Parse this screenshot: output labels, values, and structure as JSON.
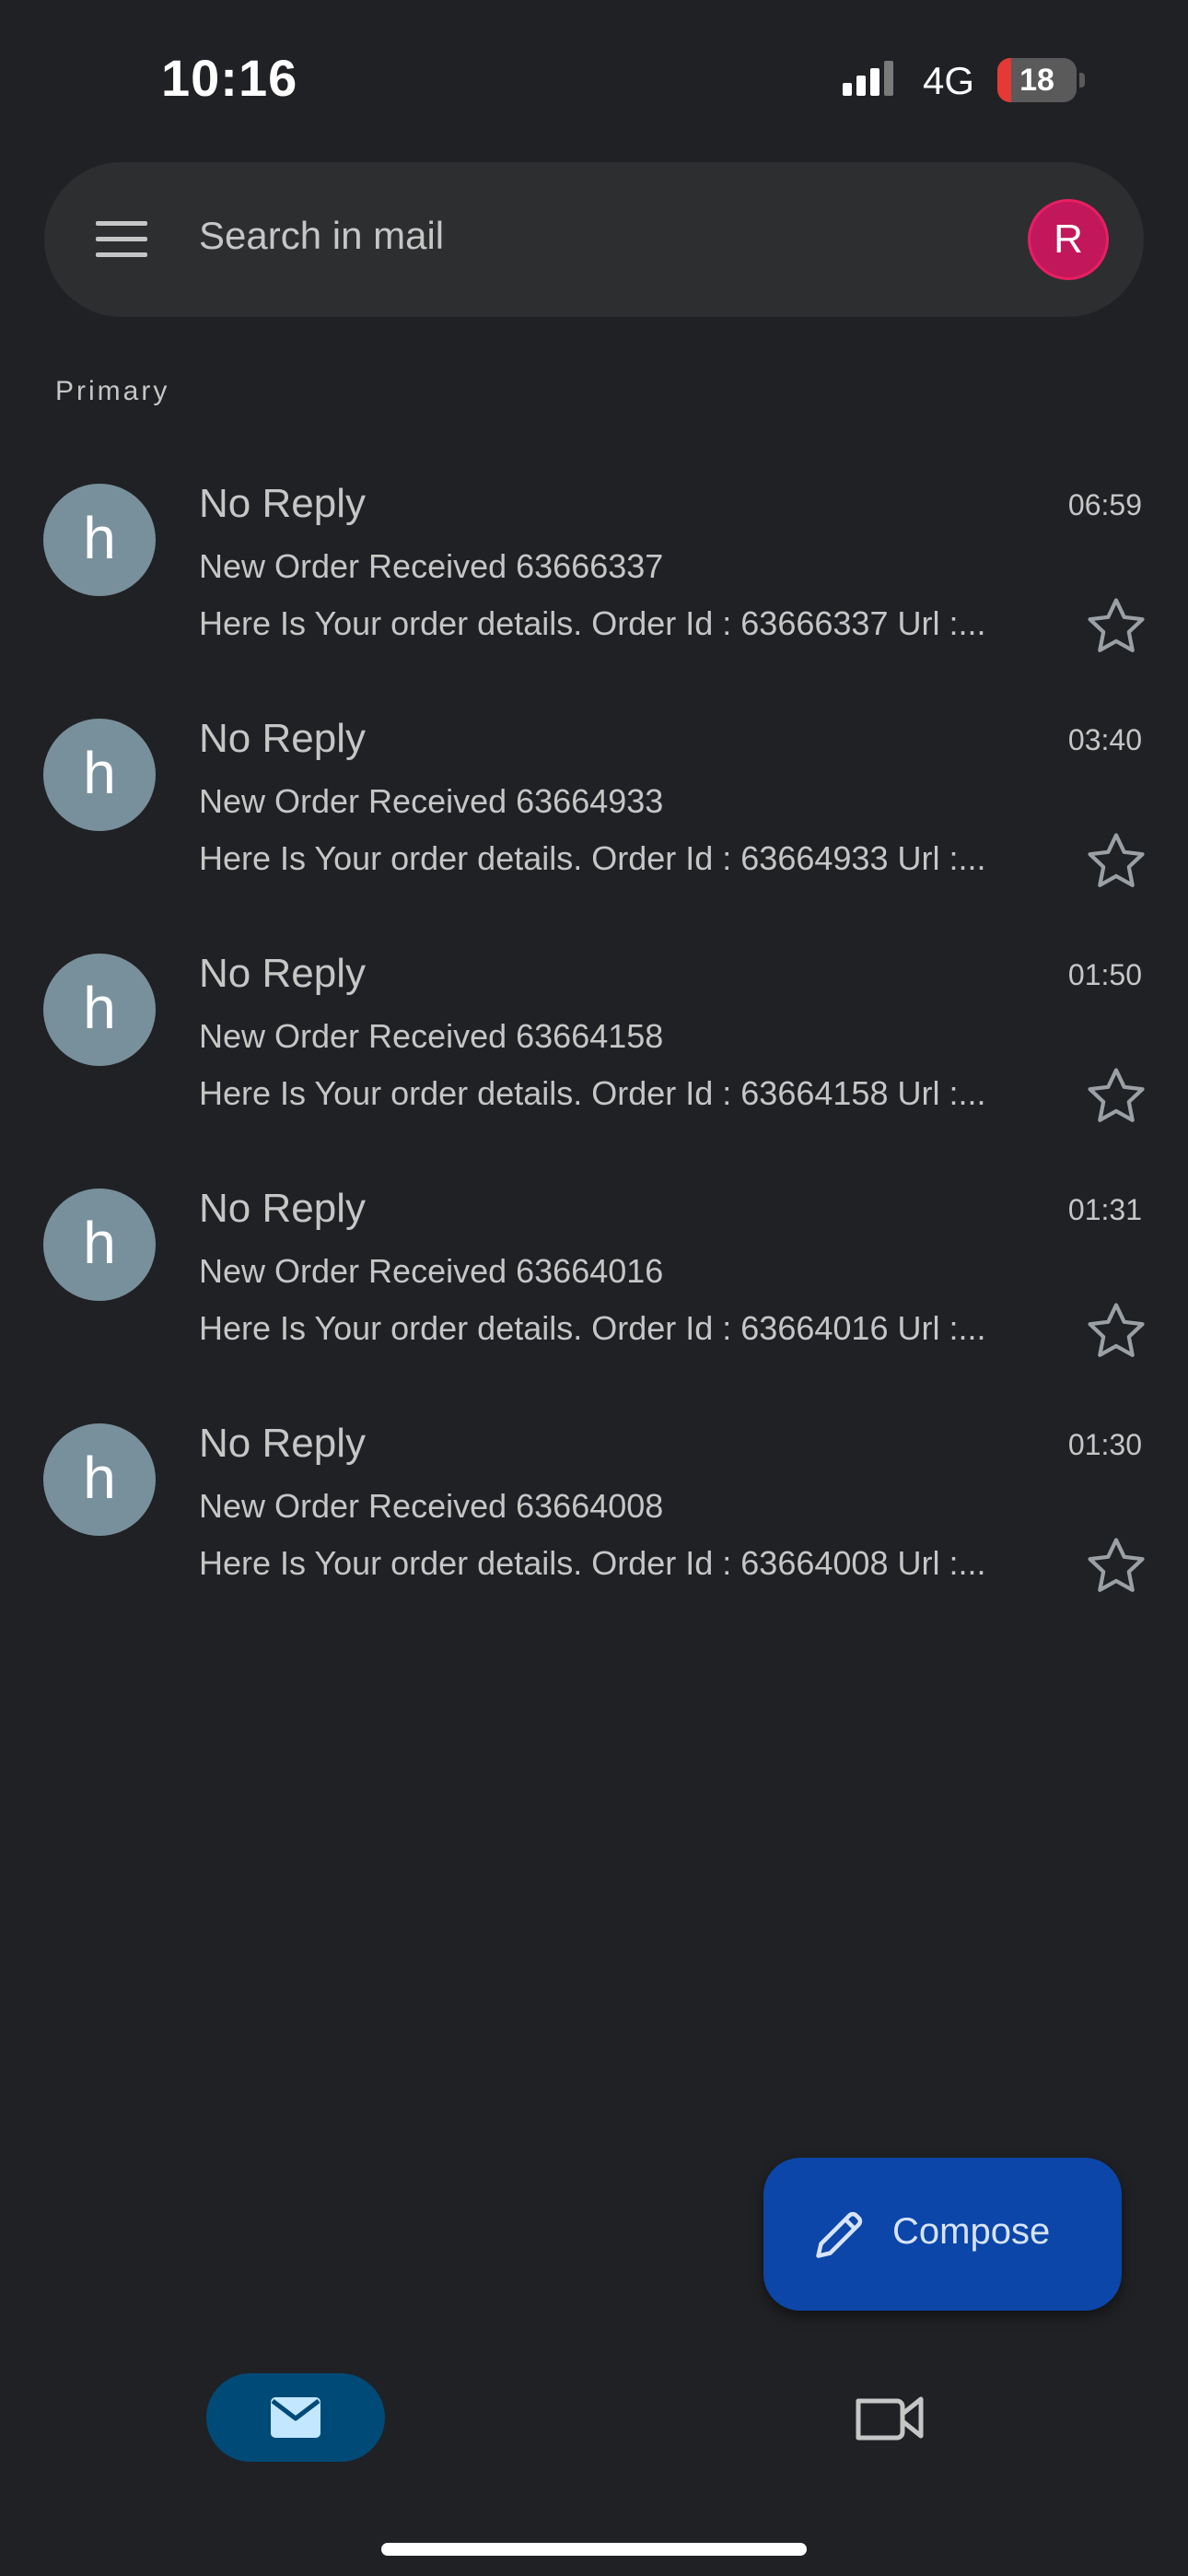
{
  "status_bar": {
    "time": "10:16",
    "network": "4G",
    "battery": "18",
    "battery_fraction": 0.18,
    "battery_color": "#e53935"
  },
  "search": {
    "placeholder": "Search in mail",
    "account_initial": "R",
    "account_color": "#c2185b",
    "menu_icon": "hamburger-menu-icon"
  },
  "section": {
    "label": "Primary"
  },
  "emails": [
    {
      "avatar_letter": "h",
      "sender": "No Reply",
      "time": "06:59",
      "subject": "New Order Received 63666337",
      "snippet": "Here Is Your order details. Order Id : 63666337 Url :...",
      "starred": false
    },
    {
      "avatar_letter": "h",
      "sender": "No Reply",
      "time": "03:40",
      "subject": "New Order Received 63664933",
      "snippet": "Here Is Your order details. Order Id : 63664933 Url :...",
      "starred": false
    },
    {
      "avatar_letter": "h",
      "sender": "No Reply",
      "time": "01:50",
      "subject": "New Order Received 63664158",
      "snippet": "Here Is Your order details. Order Id : 63664158 Url :...",
      "starred": false
    },
    {
      "avatar_letter": "h",
      "sender": "No Reply",
      "time": "01:31",
      "subject": "New Order Received 63664016",
      "snippet": "Here Is Your order details. Order Id : 63664016 Url :...",
      "starred": false
    },
    {
      "avatar_letter": "h",
      "sender": "No Reply",
      "time": "01:30",
      "subject": "New Order Received 63664008",
      "snippet": "Here Is Your order details. Order Id : 63664008 Url :...",
      "starred": false
    }
  ],
  "compose": {
    "label": "Compose",
    "icon": "pencil-icon",
    "color": "#0b46a8"
  },
  "bottom_nav": {
    "items": [
      {
        "icon": "mail-icon",
        "active": true
      },
      {
        "icon": "video-camera-icon",
        "active": false
      }
    ]
  }
}
